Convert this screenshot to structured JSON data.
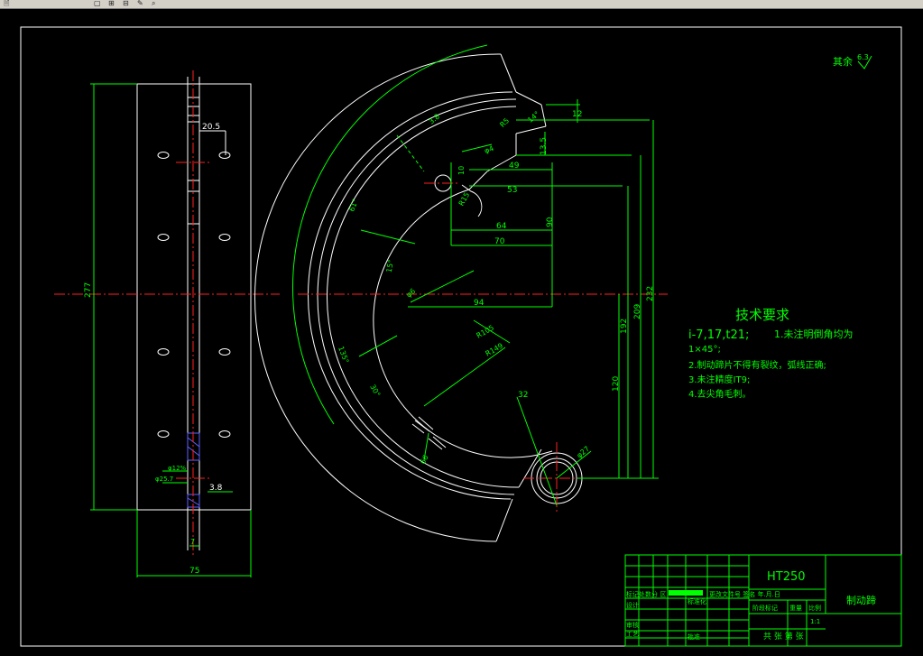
{
  "toolbar": {
    "glyphs": [
      "🗎",
      "▢",
      "⊞",
      "⊟",
      "✎",
      "⌕"
    ]
  },
  "roughness": {
    "label": "其余",
    "value": "6.3"
  },
  "tech_requirements": {
    "title": "技术要求",
    "lines": [
      "i-7,17,t21;",
      "1.未注明倒角均为",
      "1×45°;",
      "2.制动蹄片不得有裂纹，弧线正确;",
      "3.未注精度IT9;",
      "4.去尖角毛刺。"
    ]
  },
  "left_view_dims": {
    "height": "277",
    "width": "75",
    "hole_offset": "20.5",
    "slot_a": "3.8",
    "slot_b": "7",
    "hole_dia_a": "φ25.7",
    "hole_dia_b": "φ12%"
  },
  "right_view_dims": {
    "d12": "12",
    "d135": "13.5",
    "d49": "49",
    "d53": "53",
    "d64": "64",
    "d70": "70",
    "d94": "94",
    "d90": "90",
    "d120": "120",
    "d192": "192",
    "d209": "209",
    "d232": "232",
    "d10": "10",
    "phi4": "φ4",
    "r5": "R5",
    "r15": "R15",
    "r105": "R105",
    "r149": "R149",
    "phi27": "φ27",
    "d32": "32",
    "angle_a": "15°",
    "angle_b": "50°",
    "angle_c": "61°",
    "angle_d": "135°",
    "angle_e": "30°",
    "d66": "66",
    "d14": "14°",
    "phi6": "φ6",
    "d3_8": "3.8"
  },
  "title_block": {
    "material": "HT250",
    "part_name": "制动蹄",
    "row_label_1": "标记处数分  区",
    "row_label_2": "更改文件号  签名 年.月.日",
    "design": "设计",
    "standard": "标准化",
    "stage": "阶段标记",
    "weight": "重量",
    "ratio": "比例",
    "scale": "1:1",
    "review": "审核",
    "process": "工艺",
    "approve": "批准",
    "sheets": "共 张 第 张"
  }
}
